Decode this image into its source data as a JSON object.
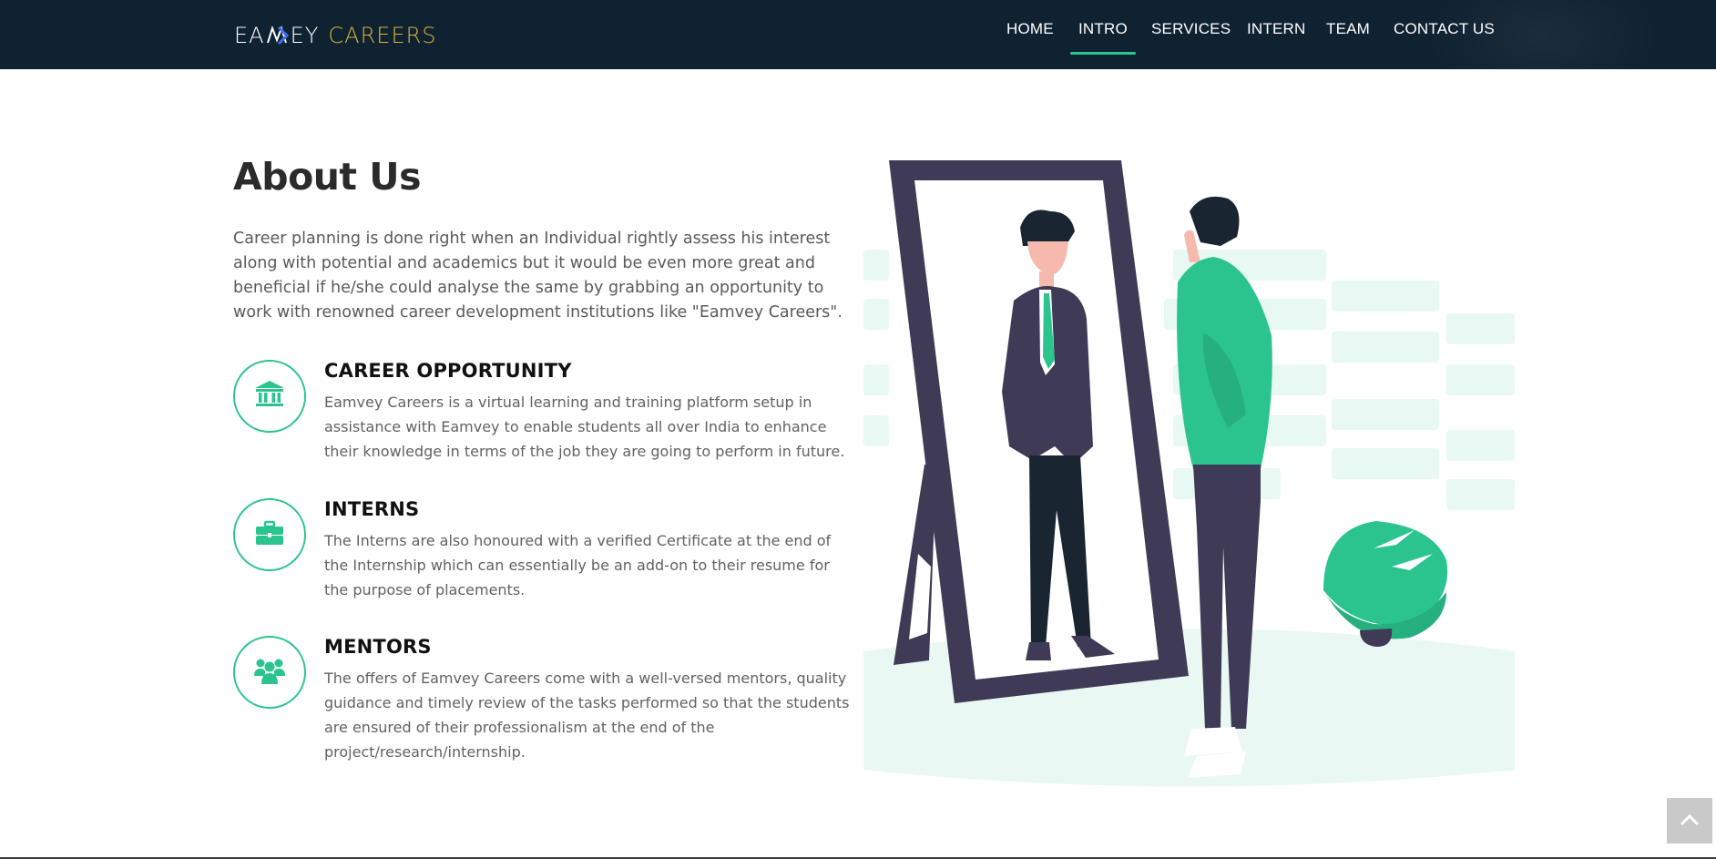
{
  "header": {
    "logo": {
      "part_a": "EA",
      "part_b": "EY",
      "part_c": "CAREERS"
    },
    "nav": [
      {
        "label": "HOME",
        "active": false
      },
      {
        "label": "INTRO",
        "active": true
      },
      {
        "label": "SERVICES",
        "active": false
      },
      {
        "label": "INTERN",
        "active": false
      },
      {
        "label": "TEAM",
        "active": false
      },
      {
        "label": "CONTACT US",
        "active": false
      }
    ]
  },
  "about": {
    "title": "About Us",
    "lead": "Career planning is done right when an Individual rightly assess his interest along with potential and academics but it would be even more great and beneficial if he/she could analyse the same by grabbing an opportunity to work with renowned career development institutions like \"Eamvey Careers\".",
    "features": [
      {
        "icon": "bank-icon",
        "title": "CAREER OPPORTUNITY",
        "text": "Eamvey Careers is a virtual learning and training platform setup in assistance with Eamvey to enable students all over India to enhance their knowledge in terms of the job they are going to perform in future."
      },
      {
        "icon": "briefcase-icon",
        "title": "INTERNS",
        "text": "The Interns are also honoured with a verified Certificate at the end of the Internship which can essentially be an add-on to their resume for the purpose of placements."
      },
      {
        "icon": "users-icon",
        "title": "MENTORS",
        "text": "The offers of Eamvey Careers come with a well-versed mentors, quality guidance and timely review of the tasks performed so that the students are ensured of their professionalism at the end of the project/research/internship."
      }
    ]
  },
  "illustration": {
    "name": "mirror-illustration"
  },
  "back_to_top": {
    "icon": "chevron-up-icon"
  },
  "colors": {
    "nav_bg": "#0f2231",
    "accent": "#2bc48e",
    "logo_gold": "#d9b23a",
    "heading": "#2b2b2b",
    "body_text": "#5a5a5a"
  }
}
